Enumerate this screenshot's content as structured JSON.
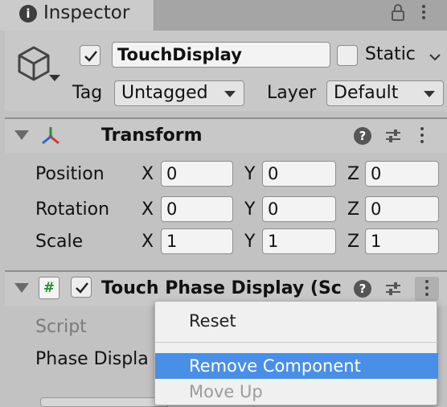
{
  "tab": {
    "title": "Inspector",
    "info_icon": "i"
  },
  "gameobject": {
    "active": true,
    "name": "TouchDisplay",
    "static_label": "Static",
    "static": false,
    "tag_label": "Tag",
    "tag_value": "Untagged",
    "layer_label": "Layer",
    "layer_value": "Default"
  },
  "transform": {
    "title": "Transform",
    "help_icon": "?",
    "rows": [
      {
        "label": "Position",
        "x": "0",
        "y": "0",
        "z": "0"
      },
      {
        "label": "Rotation",
        "x": "0",
        "y": "0",
        "z": "0"
      },
      {
        "label": "Scale",
        "x": "1",
        "y": "1",
        "z": "1"
      }
    ],
    "axis_labels": {
      "x": "X",
      "y": "Y",
      "z": "Z"
    }
  },
  "touch_phase_display": {
    "title": "Touch Phase Display (Scri",
    "enabled": true,
    "script_icon": "#",
    "help_icon": "?",
    "fields": [
      {
        "label": "Script"
      },
      {
        "label": "Phase Displa"
      }
    ]
  },
  "context_menu": {
    "items": [
      {
        "label": "Reset",
        "enabled": true
      },
      {
        "label": "Remove Component",
        "enabled": true,
        "highlighted": true
      },
      {
        "label": "Move Up",
        "enabled": false
      }
    ]
  },
  "colors": {
    "highlight": "#4a8fe6",
    "transform_axis_x": "#d9322c",
    "transform_axis_y": "#2c8d3a",
    "transform_axis_z": "#2f63d0"
  }
}
